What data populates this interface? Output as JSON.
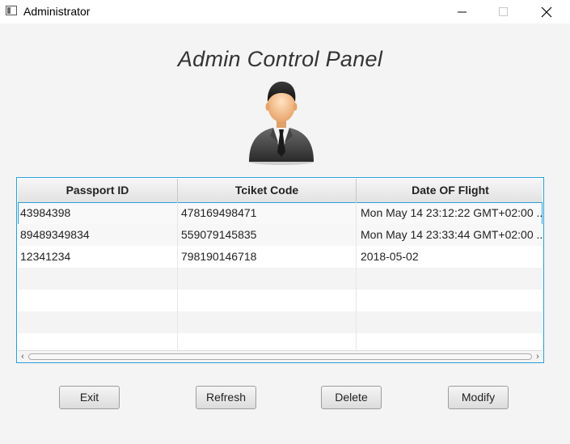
{
  "window": {
    "title": "Administrator",
    "controls": [
      "minimize-icon",
      "maximize-icon",
      "close-icon"
    ]
  },
  "panel": {
    "title": "Admin Control Panel",
    "avatar_icon": "businessman-avatar-icon"
  },
  "table": {
    "columns": [
      "Passport ID",
      "Tciket Code",
      "Date OF Flight"
    ],
    "rows": [
      [
        "43984398",
        "478169498471",
        "Mon May 14 23:12:22 GMT+02:00 ..."
      ],
      [
        "89489349834",
        "559079145835",
        "Mon May 14 23:33:44 GMT+02:00 ..."
      ],
      [
        "12341234",
        "798190146718",
        "2018-05-02"
      ]
    ],
    "selected_row": 0,
    "accent_color": "#2a9fd6"
  },
  "buttons": {
    "exit": "Exit",
    "refresh": "Refresh",
    "delete": "Delete",
    "modify": "Modify"
  }
}
